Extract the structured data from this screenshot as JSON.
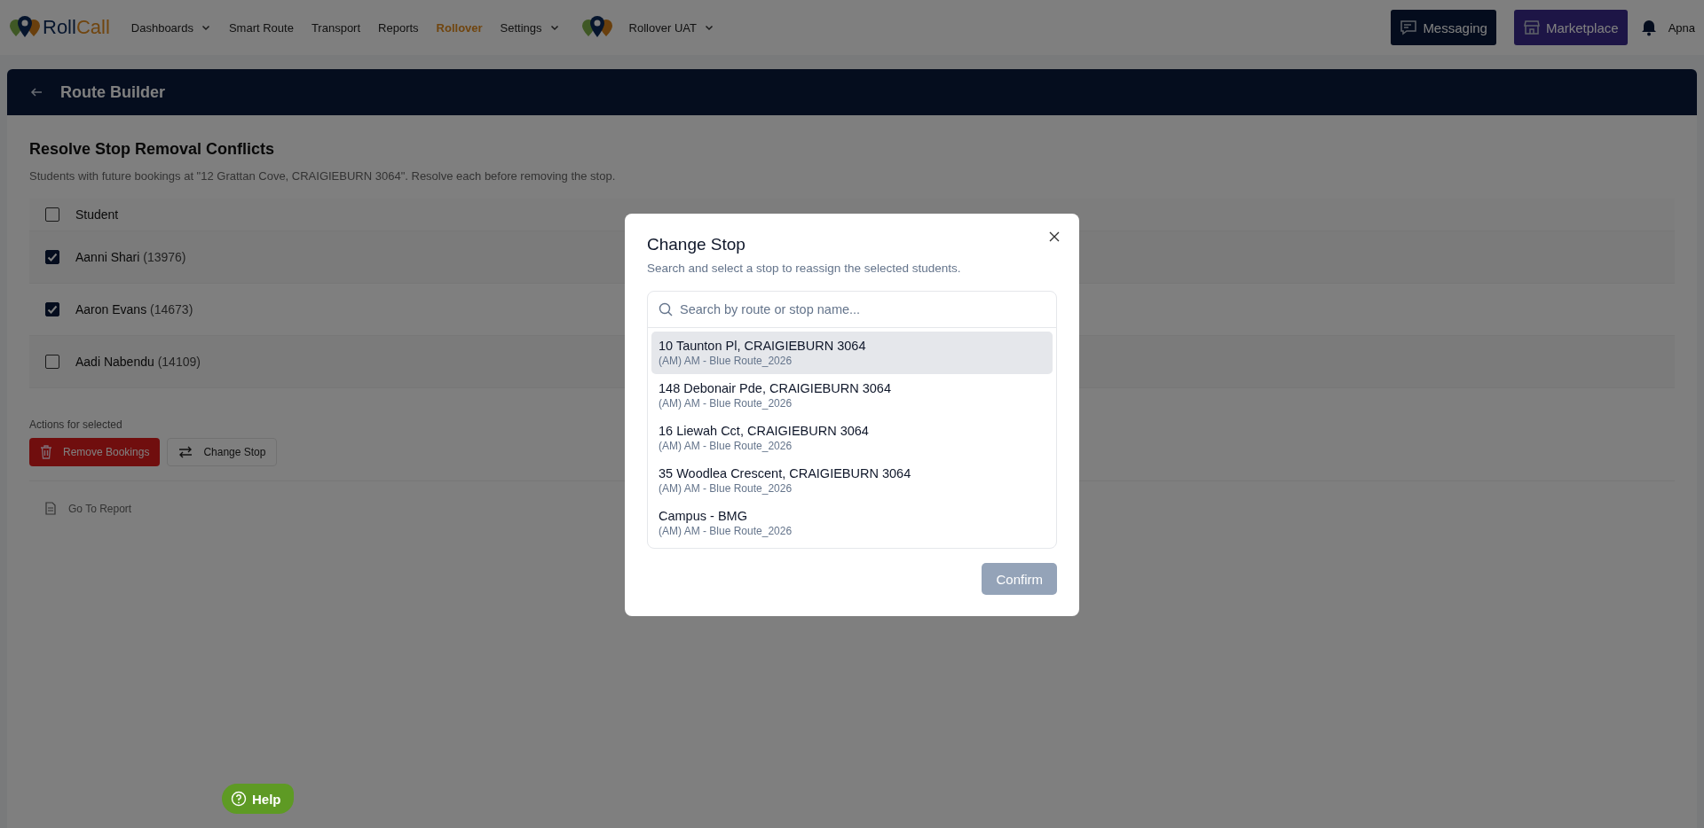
{
  "nav": {
    "logo": {
      "first": "Roll",
      "second": "Call"
    },
    "items": [
      {
        "label": "Dashboards",
        "dropdown": true,
        "selected": false
      },
      {
        "label": "Smart Route",
        "dropdown": false,
        "selected": false
      },
      {
        "label": "Transport",
        "dropdown": false,
        "selected": false
      },
      {
        "label": "Reports",
        "dropdown": false,
        "selected": false
      },
      {
        "label": "Rollover",
        "dropdown": false,
        "selected": true
      },
      {
        "label": "Settings",
        "dropdown": true,
        "selected": false
      }
    ],
    "workspace": "Rollover UAT",
    "messaging": "Messaging",
    "marketplace": "Marketplace",
    "user": "Apna"
  },
  "page": {
    "title": "Route Builder",
    "heading": "Resolve Stop Removal Conflicts",
    "description": "Students with future bookings at \"12 Grattan Cove, CRAIGIEBURN 3064\". Resolve each before removing the stop.",
    "table": {
      "columns": [
        "Student"
      ],
      "select_all_checked": false,
      "rows": [
        {
          "name": "Aanni Shari",
          "id": "(13976)",
          "checked": true
        },
        {
          "name": "Aaron Evans",
          "id": "(14673)",
          "checked": true
        },
        {
          "name": "Aadi Nabendu",
          "id": "(14109)",
          "checked": false
        }
      ]
    },
    "actions_label": "Actions for selected",
    "remove_button": "Remove Bookings",
    "change_button": "Change Stop",
    "report_link": "Go To Report"
  },
  "help": "Help",
  "modal": {
    "title": "Change Stop",
    "subtitle": "Search and select a stop to reassign the selected students.",
    "search": {
      "placeholder": "Search by route or stop name..."
    },
    "stops": [
      {
        "name": "10 Taunton Pl, CRAIGIEBURN 3064",
        "route": "(AM) AM - Blue Route_2026",
        "selected": true
      },
      {
        "name": "148 Debonair Pde, CRAIGIEBURN 3064",
        "route": "(AM) AM - Blue Route_2026",
        "selected": false
      },
      {
        "name": "16 Liewah Cct, CRAIGIEBURN 3064",
        "route": "(AM) AM - Blue Route_2026",
        "selected": false
      },
      {
        "name": "35 Woodlea Crescent, CRAIGIEBURN 3064",
        "route": "(AM) AM - Blue Route_2026",
        "selected": false
      },
      {
        "name": "Campus - BMG",
        "route": "(AM) AM - Blue Route_2026",
        "selected": false
      }
    ],
    "confirm": {
      "label": "Confirm",
      "disabled": true
    }
  }
}
